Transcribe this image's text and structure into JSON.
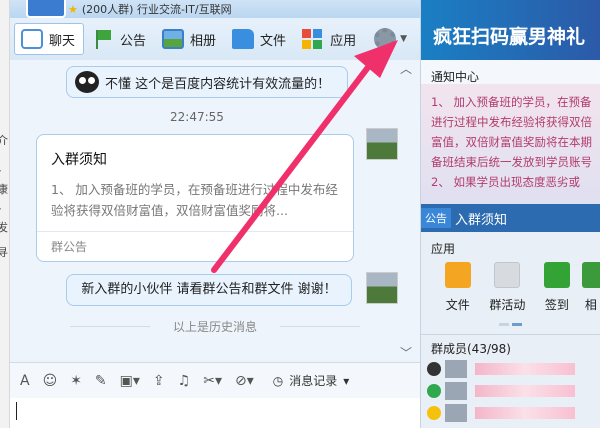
{
  "window": {
    "title": "(200人群) 行业交流-IT/互联网"
  },
  "left_strip": [
    "介",
    "/康",
    "/发",
    "寻"
  ],
  "toolbar": {
    "items": [
      {
        "label": "聊天",
        "icon": "chat-bubble-icon",
        "active": true
      },
      {
        "label": "公告",
        "icon": "flag-icon"
      },
      {
        "label": "相册",
        "icon": "photo-icon"
      },
      {
        "label": "文件",
        "icon": "folder-icon"
      },
      {
        "label": "应用",
        "icon": "apps-icon"
      }
    ],
    "settings_icon": "gear-icon"
  },
  "chat": {
    "system_msg_1": "不懂 这个是百度内容统计有效流量的！",
    "timestamp": "22:47:55",
    "card": {
      "title": "入群须知",
      "body": "1、 加入预备班的学员，在预备班进行过程中发布经验将获得双倍财富值，双倍财富值奖励将...",
      "footer": "群公告"
    },
    "system_msg_2": "新入群的小伙伴 请看群公告和群文件 谢谢！",
    "history_label": "以上是历史消息"
  },
  "input_toolbar": {
    "icons": [
      "font-icon",
      "emoji-icon",
      "shake-icon",
      "edit-icon",
      "image-icon",
      "upload-icon",
      "music-icon",
      "scissors-icon",
      "block-icon"
    ],
    "history_button": "消息记录"
  },
  "side": {
    "banner": "疯狂扫码赢男神礼",
    "notice_header": "通知中心",
    "notice_lines": [
      "1、 加入预备班的学员，在预备",
      "进行过程中发布经验将获得双倍",
      "富值，双倍财富值奖励将在本期",
      "备班结束后统一发放到学员账号",
      "2、 如果学员出现态度恶劣或"
    ],
    "notice_tag": "公告",
    "notice_title": "入群须知",
    "apps_header": "应用",
    "apps": [
      {
        "label": "文件",
        "icon": "folder-icon"
      },
      {
        "label": "群活动",
        "icon": "grid-icon"
      },
      {
        "label": "签到",
        "icon": "checkbox-icon"
      },
      {
        "label": "相",
        "icon": "photo-icon"
      }
    ],
    "members_header": "群成员(43/98)",
    "member_badges": [
      "qq-penguin-icon",
      "dialog-icon",
      "star-icon"
    ]
  },
  "colors": {
    "accent": "#2d6bb0",
    "bubble_border": "#a9cbee",
    "notice_text": "#b23b6f"
  }
}
